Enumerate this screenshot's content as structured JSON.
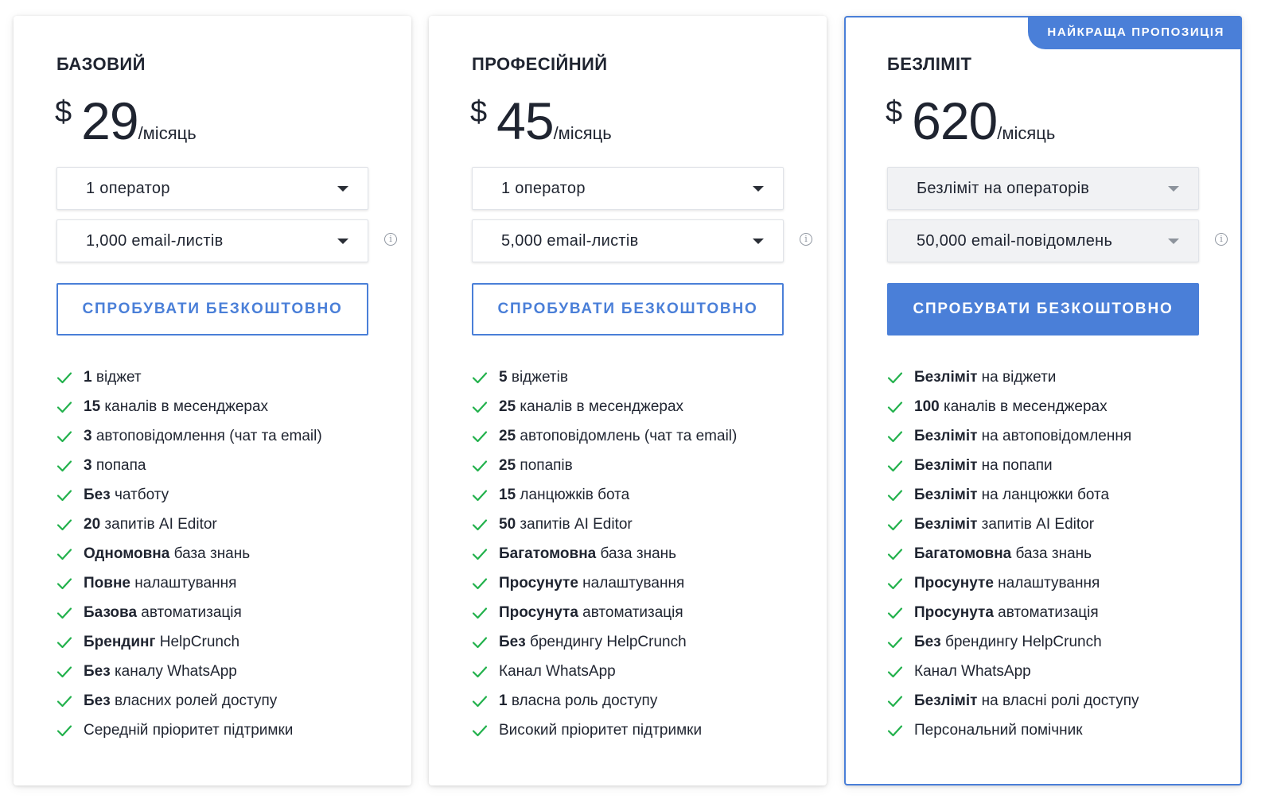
{
  "featured_badge": "НАЙКРАЩА ПРОПОЗИЦІЯ",
  "accent_color": "#4a7fd8",
  "check_color": "#22b14c",
  "plans": [
    {
      "name": "БАЗОВИЙ",
      "currency": "$",
      "price": "29",
      "period": "/місяць",
      "operators": "1 оператор",
      "emails": "1,000 email-листів",
      "cta": "СПРОБУВАТИ БЕЗКОШТОВНО",
      "features": [
        {
          "bold": "1",
          "text": " віджет"
        },
        {
          "bold": "15",
          "text": " каналів в месенджерах"
        },
        {
          "bold": "3",
          "text": " автоповідомлення (чат та email)"
        },
        {
          "bold": "3",
          "text": " попапа"
        },
        {
          "bold": "Без",
          "text": " чатботу"
        },
        {
          "bold": "20",
          "text": " запитів AI Editor"
        },
        {
          "bold": "Одномовна",
          "text": " база знань"
        },
        {
          "bold": "Повне",
          "text": " налаштування"
        },
        {
          "bold": "Базова",
          "text": " автоматизація"
        },
        {
          "bold": "Брендинг",
          "text": " HelpCrunch"
        },
        {
          "bold": "Без",
          "text": " каналу WhatsApp"
        },
        {
          "bold": "Без",
          "text": " власних ролей доступу"
        },
        {
          "bold": "",
          "text": "Середній пріоритет підтримки"
        }
      ]
    },
    {
      "name": "ПРОФЕСІЙНИЙ",
      "currency": "$",
      "price": "45",
      "period": "/місяць",
      "operators": "1 оператор",
      "emails": "5,000 email-листів",
      "cta": "СПРОБУВАТИ БЕЗКОШТОВНО",
      "features": [
        {
          "bold": "5",
          "text": " віджетів"
        },
        {
          "bold": "25",
          "text": " каналів в месенджерах"
        },
        {
          "bold": "25",
          "text": " автоповідомлень (чат та email)"
        },
        {
          "bold": "25",
          "text": " попапів"
        },
        {
          "bold": "15",
          "text": " ланцюжків бота"
        },
        {
          "bold": "50",
          "text": " запитів AI Editor"
        },
        {
          "bold": "Багатомовна",
          "text": " база знань"
        },
        {
          "bold": "Просунуте",
          "text": " налаштування"
        },
        {
          "bold": "Просунута",
          "text": " автоматизація"
        },
        {
          "bold": "Без",
          "text": " брендингу HelpCrunch"
        },
        {
          "bold": "",
          "text": "Канал WhatsApp"
        },
        {
          "bold": "1",
          "text": " власна роль доступу"
        },
        {
          "bold": "",
          "text": "Високий пріоритет підтримки"
        }
      ]
    },
    {
      "name": "БЕЗЛІМІТ",
      "currency": "$",
      "price": "620",
      "period": "/місяць",
      "operators": "Безліміт на операторів",
      "emails": "50,000 email-повідомлень",
      "cta": "СПРОБУВАТИ БЕЗКОШТОВНО",
      "features": [
        {
          "bold": "Безліміт",
          "text": " на віджети"
        },
        {
          "bold": "100",
          "text": " каналів в месенджерах"
        },
        {
          "bold": "Безліміт",
          "text": " на автоповідомлення"
        },
        {
          "bold": "Безліміт",
          "text": " на попапи"
        },
        {
          "bold": "Безліміт",
          "text": " на ланцюжки бота"
        },
        {
          "bold": "Безліміт",
          "text": " запитів AI Editor"
        },
        {
          "bold": "Багатомовна",
          "text": " база знань"
        },
        {
          "bold": "Просунуте",
          "text": " налаштування"
        },
        {
          "bold": "Просунута",
          "text": " автоматизація"
        },
        {
          "bold": "Без",
          "text": " брендингу HelpCrunch"
        },
        {
          "bold": "",
          "text": "Канал WhatsApp"
        },
        {
          "bold": "Безліміт",
          "text": " на власні ролі доступу"
        },
        {
          "bold": "",
          "text": "Персональний помічник"
        }
      ]
    }
  ]
}
